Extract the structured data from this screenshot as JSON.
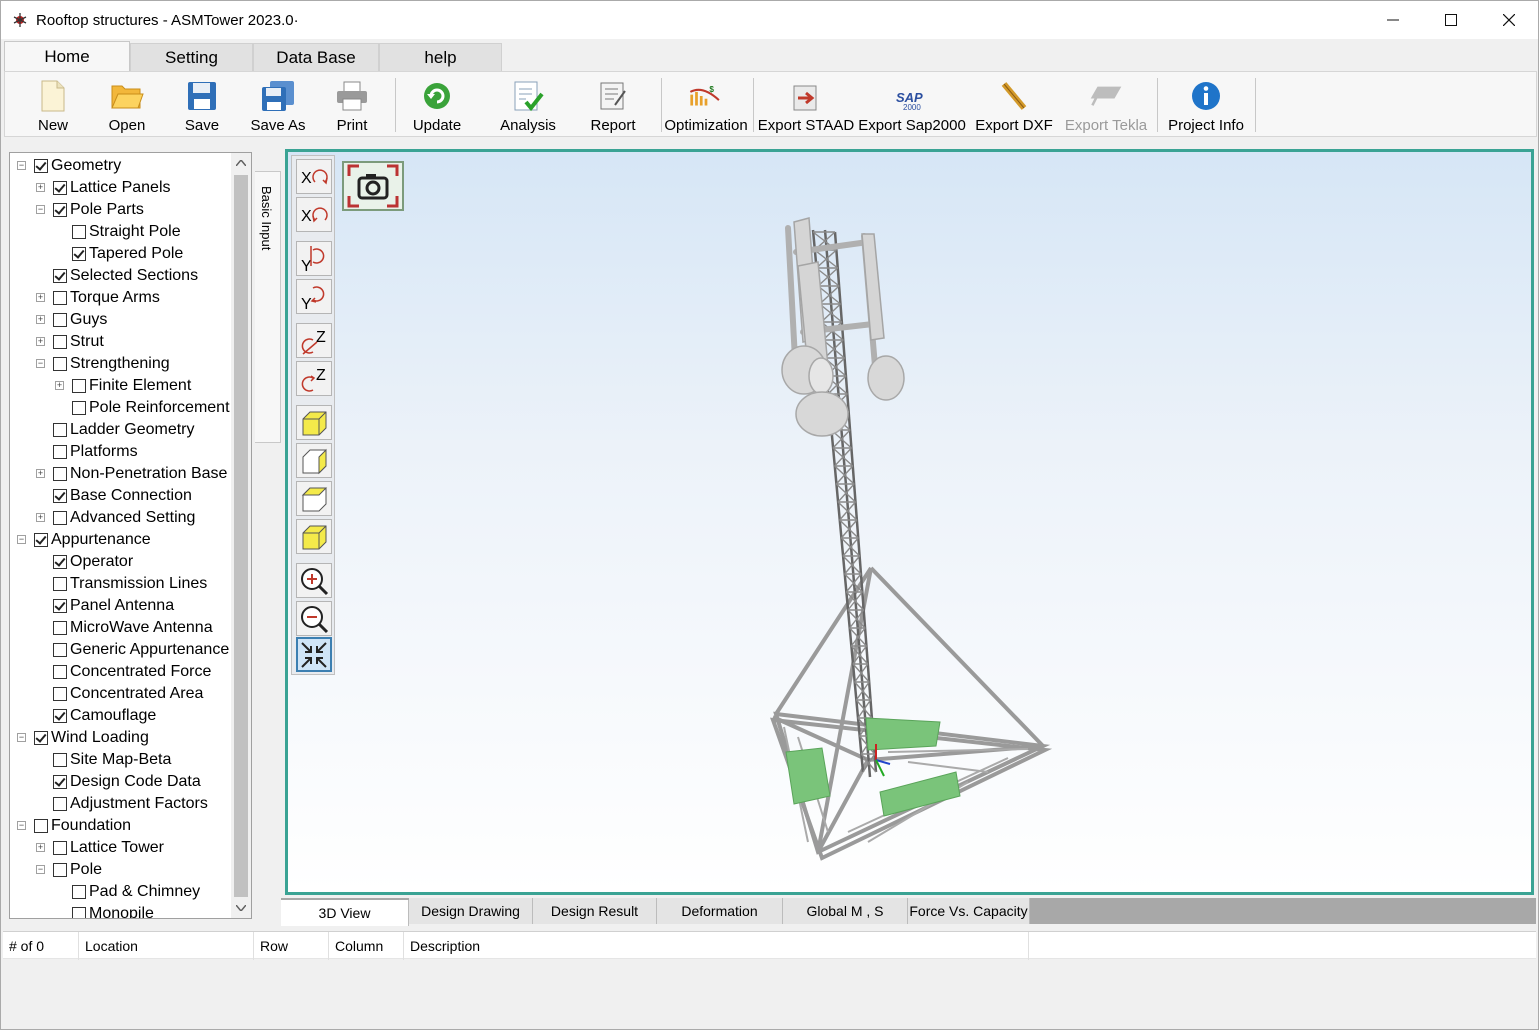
{
  "window": {
    "title": "Rooftop structures - ASMTower 2023.0·"
  },
  "ribbon_tabs": [
    "Home",
    "Setting",
    "Data Base",
    "help"
  ],
  "toolbar": {
    "new": "New",
    "open": "Open",
    "save": "Save",
    "save_as": "Save As",
    "print": "Print",
    "update": "Update",
    "analysis": "Analysis",
    "report": "Report",
    "optimization": "Optimization",
    "export_staad": "Export STAAD",
    "export_sap2000": "Export Sap2000",
    "export_dxf": "Export DXF",
    "export_tekla": "Export Tekla",
    "project_info": "Project Info"
  },
  "tree": [
    {
      "label": "Geometry",
      "checked": true
    },
    {
      "label": "Lattice Panels",
      "checked": true
    },
    {
      "label": "Pole Parts",
      "checked": true
    },
    {
      "label": "Straight Pole",
      "checked": false
    },
    {
      "label": "Tapered Pole",
      "checked": true
    },
    {
      "label": "Selected Sections",
      "checked": true
    },
    {
      "label": "Torque Arms",
      "checked": false
    },
    {
      "label": "Guys",
      "checked": false
    },
    {
      "label": "Strut",
      "checked": false
    },
    {
      "label": "Strengthening",
      "checked": false
    },
    {
      "label": "Finite Element",
      "checked": false
    },
    {
      "label": "Pole Reinforcement",
      "checked": false
    },
    {
      "label": "Ladder Geometry",
      "checked": false
    },
    {
      "label": "Platforms",
      "checked": false
    },
    {
      "label": "Non-Penetration Base",
      "checked": false
    },
    {
      "label": "Base Connection",
      "checked": true
    },
    {
      "label": "Advanced Setting",
      "checked": false
    },
    {
      "label": "Appurtenance",
      "checked": true
    },
    {
      "label": "Operator",
      "checked": true
    },
    {
      "label": "Transmission Lines",
      "checked": false
    },
    {
      "label": "Panel Antenna",
      "checked": true
    },
    {
      "label": "MicroWave Antenna",
      "checked": false
    },
    {
      "label": "Generic Appurtenance",
      "checked": false
    },
    {
      "label": "Concentrated Force",
      "checked": false
    },
    {
      "label": "Concentrated Area",
      "checked": false
    },
    {
      "label": "Camouflage",
      "checked": true
    },
    {
      "label": "Wind Loading",
      "checked": true
    },
    {
      "label": "Site Map-Beta",
      "checked": false
    },
    {
      "label": "Design Code Data",
      "checked": true
    },
    {
      "label": "Adjustment Factors",
      "checked": false
    },
    {
      "label": "Foundation",
      "checked": false
    },
    {
      "label": "Lattice Tower",
      "checked": false
    },
    {
      "label": "Pole",
      "checked": false
    },
    {
      "label": "Pad & Chimney",
      "checked": false
    },
    {
      "label": "Monopile",
      "checked": false
    }
  ],
  "side_tab": "Basic Input",
  "view_tabs": [
    "3D View",
    "Design Drawing",
    "Design Result",
    "Deformation",
    "Global M , S",
    "Force Vs. Capacity"
  ],
  "grid_headers": [
    "# of 0",
    "Location",
    "Row",
    "Column",
    "Description"
  ],
  "colors": {
    "view_border": "#3aa394",
    "accent": "#3c7fb1",
    "antenna_green": "#7ac47a"
  },
  "icons": {
    "view_tools": [
      "rotate-x-pos-icon",
      "rotate-x-neg-icon",
      "rotate-y-pos-icon",
      "rotate-y-neg-icon",
      "rotate-z-pos-icon",
      "rotate-z-neg-icon",
      "view-front-icon",
      "view-side-icon",
      "view-top-icon",
      "view-iso-icon",
      "zoom-in-icon",
      "zoom-out-icon",
      "fit-view-icon"
    ]
  }
}
